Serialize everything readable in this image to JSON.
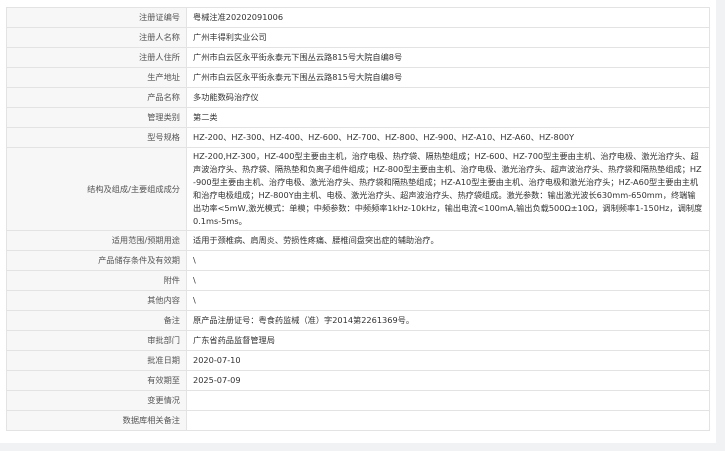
{
  "rows": [
    {
      "label": "注册证编号",
      "value": "粤械注准20202091006"
    },
    {
      "label": "注册人名称",
      "value": "广州丰得利实业公司"
    },
    {
      "label": "注册人住所",
      "value": "广州市白云区永平街永泰元下围丛云路815号大院自编8号"
    },
    {
      "label": "生产地址",
      "value": "广州市白云区永平街永泰元下围丛云路815号大院自编8号"
    },
    {
      "label": "产品名称",
      "value": "多功能数码治疗仪"
    },
    {
      "label": "管理类别",
      "value": "第二类"
    },
    {
      "label": "型号规格",
      "value": "HZ-200、HZ-300、HZ-400、HZ-600、HZ-700、HZ-800、HZ-900、HZ-A10、HZ-A60、HZ-800Y"
    },
    {
      "label": "结构及组成/主要组成成分",
      "value": "HZ-200,HZ-300，HZ-400型主要由主机，治疗电极、热疗袋、隔热垫组成；HZ-600、HZ-700型主要由主机、治疗电极、激光治疗头、超声波治疗头、热疗袋、隔热垫和负离子组件组成；HZ-800型主要由主机、治疗电极、激光治疗头、超声波治疗头、热疗袋和隔热垫组成；HZ-900型主要由主机、治疗电极、激光治疗头、热疗袋和隔热垫组成；HZ-A10型主要由主机、治疗电极和激光治疗头；HZ-A60型主要由主机和治疗电极组成；HZ-800Y由主机、电极、激光治疗头、超声波治疗头、热疗袋组成。激光参数：输出激光波长630mm-650mm，终端输出功率<5mW,激光模式：单模；中频参数：中频频率1kHz-10kHz，输出电流<100mA,输出负载500Ω±10Ω，调制频率1-150Hz，调制度0.1ms-5ms。"
    },
    {
      "label": "适用范围/预期用途",
      "value": "适用于颈椎病、肩周炎、劳损性疼痛、腰椎间盘突出症的辅助治疗。"
    },
    {
      "label": "产品储存条件及有效期",
      "value": "\\"
    },
    {
      "label": "附件",
      "value": "\\"
    },
    {
      "label": "其他内容",
      "value": "\\"
    },
    {
      "label": "备注",
      "value": "原产品注册证号：粤食药监械（准）字2014第2261369号。"
    },
    {
      "label": "审批部门",
      "value": "广东省药品监督管理局"
    },
    {
      "label": "批准日期",
      "value": "2020-07-10"
    },
    {
      "label": "有效期至",
      "value": "2025-07-09"
    },
    {
      "label": "变更情况",
      "value": ""
    },
    {
      "label": "数据库相关备注",
      "value": ""
    }
  ]
}
